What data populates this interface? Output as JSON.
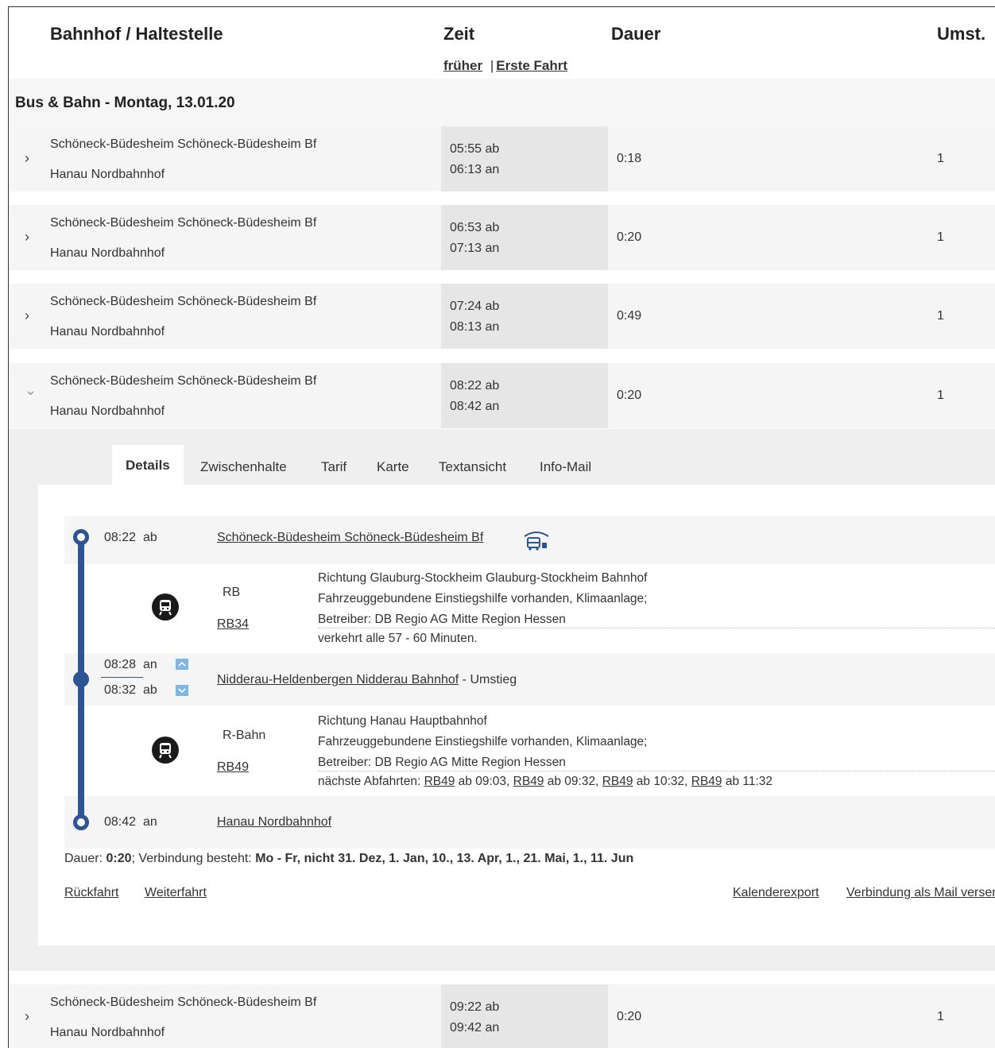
{
  "header": {
    "col_station": "Bahnhof / Haltestelle",
    "col_time": "Zeit",
    "col_duration": "Dauer",
    "col_changes": "Umst.",
    "link_earlier": "früher",
    "separator": "|",
    "link_first": "Erste Fahrt"
  },
  "day_label": "Bus & Bahn - Montag, 13.01.20",
  "rows": [
    {
      "chevron": "›",
      "from": "Schöneck-Büdesheim Schöneck-Büdesheim Bf",
      "to": "Hanau Nordbahnhof",
      "dep": "05:55 ab",
      "arr": "06:13 an",
      "duration": "0:18",
      "changes": "1"
    },
    {
      "chevron": "›",
      "from": "Schöneck-Büdesheim Schöneck-Büdesheim Bf",
      "to": "Hanau Nordbahnhof",
      "dep": "06:53 ab",
      "arr": "07:13 an",
      "duration": "0:20",
      "changes": "1"
    },
    {
      "chevron": "›",
      "from": "Schöneck-Büdesheim Schöneck-Büdesheim Bf",
      "to": "Hanau Nordbahnhof",
      "dep": "07:24 ab",
      "arr": "08:13 an",
      "duration": "0:49",
      "changes": "1"
    },
    {
      "chevron": "⌄",
      "from": "Schöneck-Büdesheim Schöneck-Büdesheim Bf",
      "to": "Hanau Nordbahnhof",
      "dep": "08:22 ab",
      "arr": "08:42 an",
      "duration": "0:20",
      "changes": "1"
    },
    {
      "chevron": "›",
      "from": "Schöneck-Büdesheim Schöneck-Büdesheim Bf",
      "to": "Hanau Nordbahnhof",
      "dep": "09:22 ab",
      "arr": "09:42 an",
      "duration": "0:20",
      "changes": "1"
    }
  ],
  "tabs": [
    "Details",
    "Zwischenhalte",
    "Tarif",
    "Karte",
    "Textansicht",
    "Info-Mail"
  ],
  "detail": {
    "stop1": {
      "time": "08:22",
      "suffix": "ab",
      "name": "Schöneck-Büdesheim Schöneck-Büdesheim Bf"
    },
    "leg1": {
      "type": "RB",
      "line": "RB34",
      "direction": "Richtung Glauburg-Stockheim Glauburg-Stockheim Bahnhof",
      "features": "Fahrzeuggebundene Einstiegshilfe vorhanden, Klimaanlage;",
      "operator": "Betreiber: DB Regio AG Mitte Region Hessen",
      "frequency": "verkehrt alle 57 - 60 Minuten."
    },
    "stop2": {
      "arr_time": "08:28",
      "arr_suffix": "an",
      "dep_time": "08:32",
      "dep_suffix": "ab",
      "name": "Nidderau-Heldenbergen Nidderau Bahnhof",
      "note": "- Umstieg"
    },
    "leg2": {
      "type": "R-Bahn",
      "line": "RB49",
      "direction": "Richtung Hanau Hauptbahnhof",
      "features": "Fahrzeuggebundene Einstiegshilfe vorhanden, Klimaanlage;",
      "operator": "Betreiber: DB Regio AG Mitte Region Hessen",
      "next_label": "nächste Abfahrten:",
      "next": [
        {
          "line": "RB49",
          "text": "ab 09:03,"
        },
        {
          "line": "RB49",
          "text": "ab 09:32,"
        },
        {
          "line": "RB49",
          "text": "ab 10:32,"
        },
        {
          "line": "RB49",
          "text": "ab 11:32"
        }
      ]
    },
    "stop3": {
      "time": "08:42",
      "suffix": "an",
      "name": "Hanau Nordbahnhof"
    },
    "summary": {
      "dur_label": "Dauer:",
      "dur_value": "0:20",
      "valid_label": "; Verbindung besteht:",
      "valid_value": "Mo - Fr, nicht 31. Dez, 1. Jan, 10., 13. Apr, 1., 21. Mai, 1., 11. Jun"
    },
    "links": {
      "return": "Rückfahrt",
      "onward": "Weiterfahrt",
      "calendar": "Kalenderexport",
      "mail": "Verbindung als Mail versenden"
    }
  },
  "colors": {
    "accent": "#2e5593",
    "row_bg": "#f5f5f5",
    "time_cell_bg": "#e6e6e6",
    "arrow_box": "#7eb7e6"
  }
}
